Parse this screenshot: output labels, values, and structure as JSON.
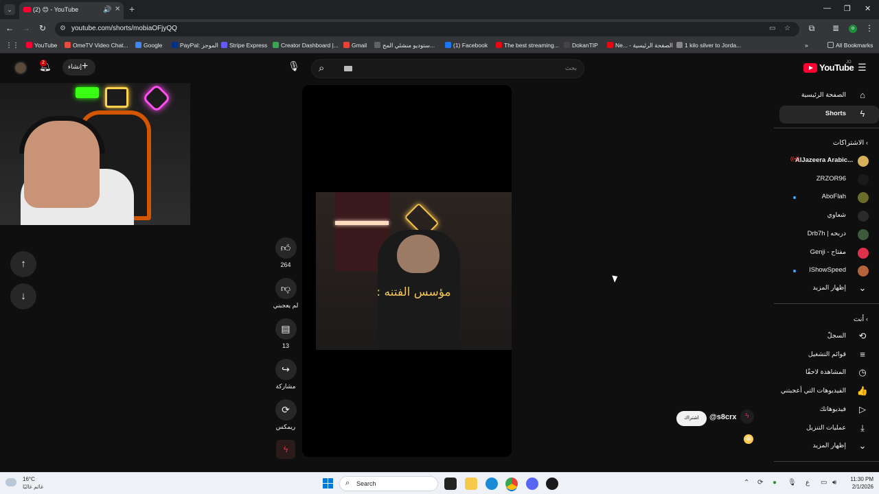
{
  "browser": {
    "tab_title": "(2) 😊 - YouTube",
    "url": "youtube.com/shorts/mobiaOFjyQQ",
    "new_tab": "+",
    "bookmarks": [
      {
        "label": "YouTube",
        "color": "#ff0033"
      },
      {
        "label": "OmeTV Video Chat...",
        "color": "#e74c3c"
      },
      {
        "label": "Google",
        "color": "#4285f4"
      },
      {
        "label": "PayPal: الموجز",
        "color": "#003087"
      },
      {
        "label": "Stripe Express",
        "color": "#635bff"
      },
      {
        "label": "Creator Dashboard |...",
        "color": "#34a853"
      },
      {
        "label": "Gmail",
        "color": "#ea4335"
      },
      {
        "label": "ستوديو منشئي المح...",
        "color": "#5f6368"
      },
      {
        "label": "(1) Facebook",
        "color": "#1877f2"
      },
      {
        "label": "The best streaming...",
        "color": "#e50914"
      },
      {
        "label": "DokanTIP",
        "color": "#444444"
      },
      {
        "label": "Ne... - الصفحة الرئيسية",
        "color": "#e50914"
      },
      {
        "label": "1 kilo silver to Jorda...",
        "color": "#888888"
      }
    ],
    "all_bookmarks": "All Bookmarks"
  },
  "youtube": {
    "search_placeholder": "بحث",
    "create_label": "إنشاء",
    "notification_count": "2",
    "logo_text": "YouTube",
    "logo_region": "JO",
    "short": {
      "caption": "مؤسس الفتنه :",
      "likes": "264",
      "dislike_label": "لم يعجبني",
      "comments": "13",
      "share_label": "مشاركة",
      "remix_label": "ريمكس"
    },
    "channel": {
      "handle": "@s8crx",
      "subscribe_label": "اشتراك"
    },
    "sidebar": {
      "home": "الصفحة الرئيسية",
      "shorts": "Shorts",
      "subscriptions_header": "الاشتراكات",
      "subscriptions": [
        {
          "name": "AlJazeera Arabic...",
          "live": true,
          "dot": false,
          "color": "#d8b15a"
        },
        {
          "name": "ZRZOR96",
          "live": false,
          "dot": false,
          "color": "#1a1a1a"
        },
        {
          "name": "AboFlah",
          "live": false,
          "dot": true,
          "color": "#6b6b2a"
        },
        {
          "name": "شعاوي",
          "live": false,
          "dot": false,
          "color": "#2a2a2a"
        },
        {
          "name": "Drb7h | دربحه",
          "live": false,
          "dot": false,
          "color": "#3b5b3b"
        },
        {
          "name": "Genji - مفتاح",
          "live": false,
          "dot": false,
          "color": "#e0314b"
        },
        {
          "name": "IShowSpeed",
          "live": false,
          "dot": true,
          "color": "#b5643a"
        }
      ],
      "show_more_1": "إظهار المزيد",
      "you_header": "أنت",
      "you_items": [
        {
          "label": "السجلّ",
          "icon": "history-icon",
          "glyph": "⟲"
        },
        {
          "label": "قوائم التشغيل",
          "icon": "playlists-icon",
          "glyph": "≡"
        },
        {
          "label": "المشاهدة لاحقًا",
          "icon": "watch-later-icon",
          "glyph": "◷"
        },
        {
          "label": "الفيديوهات التي أعجبتني",
          "icon": "liked-icon",
          "glyph": "👍"
        },
        {
          "label": "فيديوهاتك",
          "icon": "your-videos-icon",
          "glyph": "▷"
        },
        {
          "label": "عمليات التنزيل",
          "icon": "download-icon",
          "glyph": "⤓"
        }
      ],
      "show_more_2": "إظهار المزيد"
    }
  },
  "taskbar": {
    "temperature": "16°C",
    "weather_desc": "غائم غالبًا",
    "search_label": "Search",
    "time": "11:30 PM",
    "date": "2/1/2026",
    "lang": "ع"
  }
}
